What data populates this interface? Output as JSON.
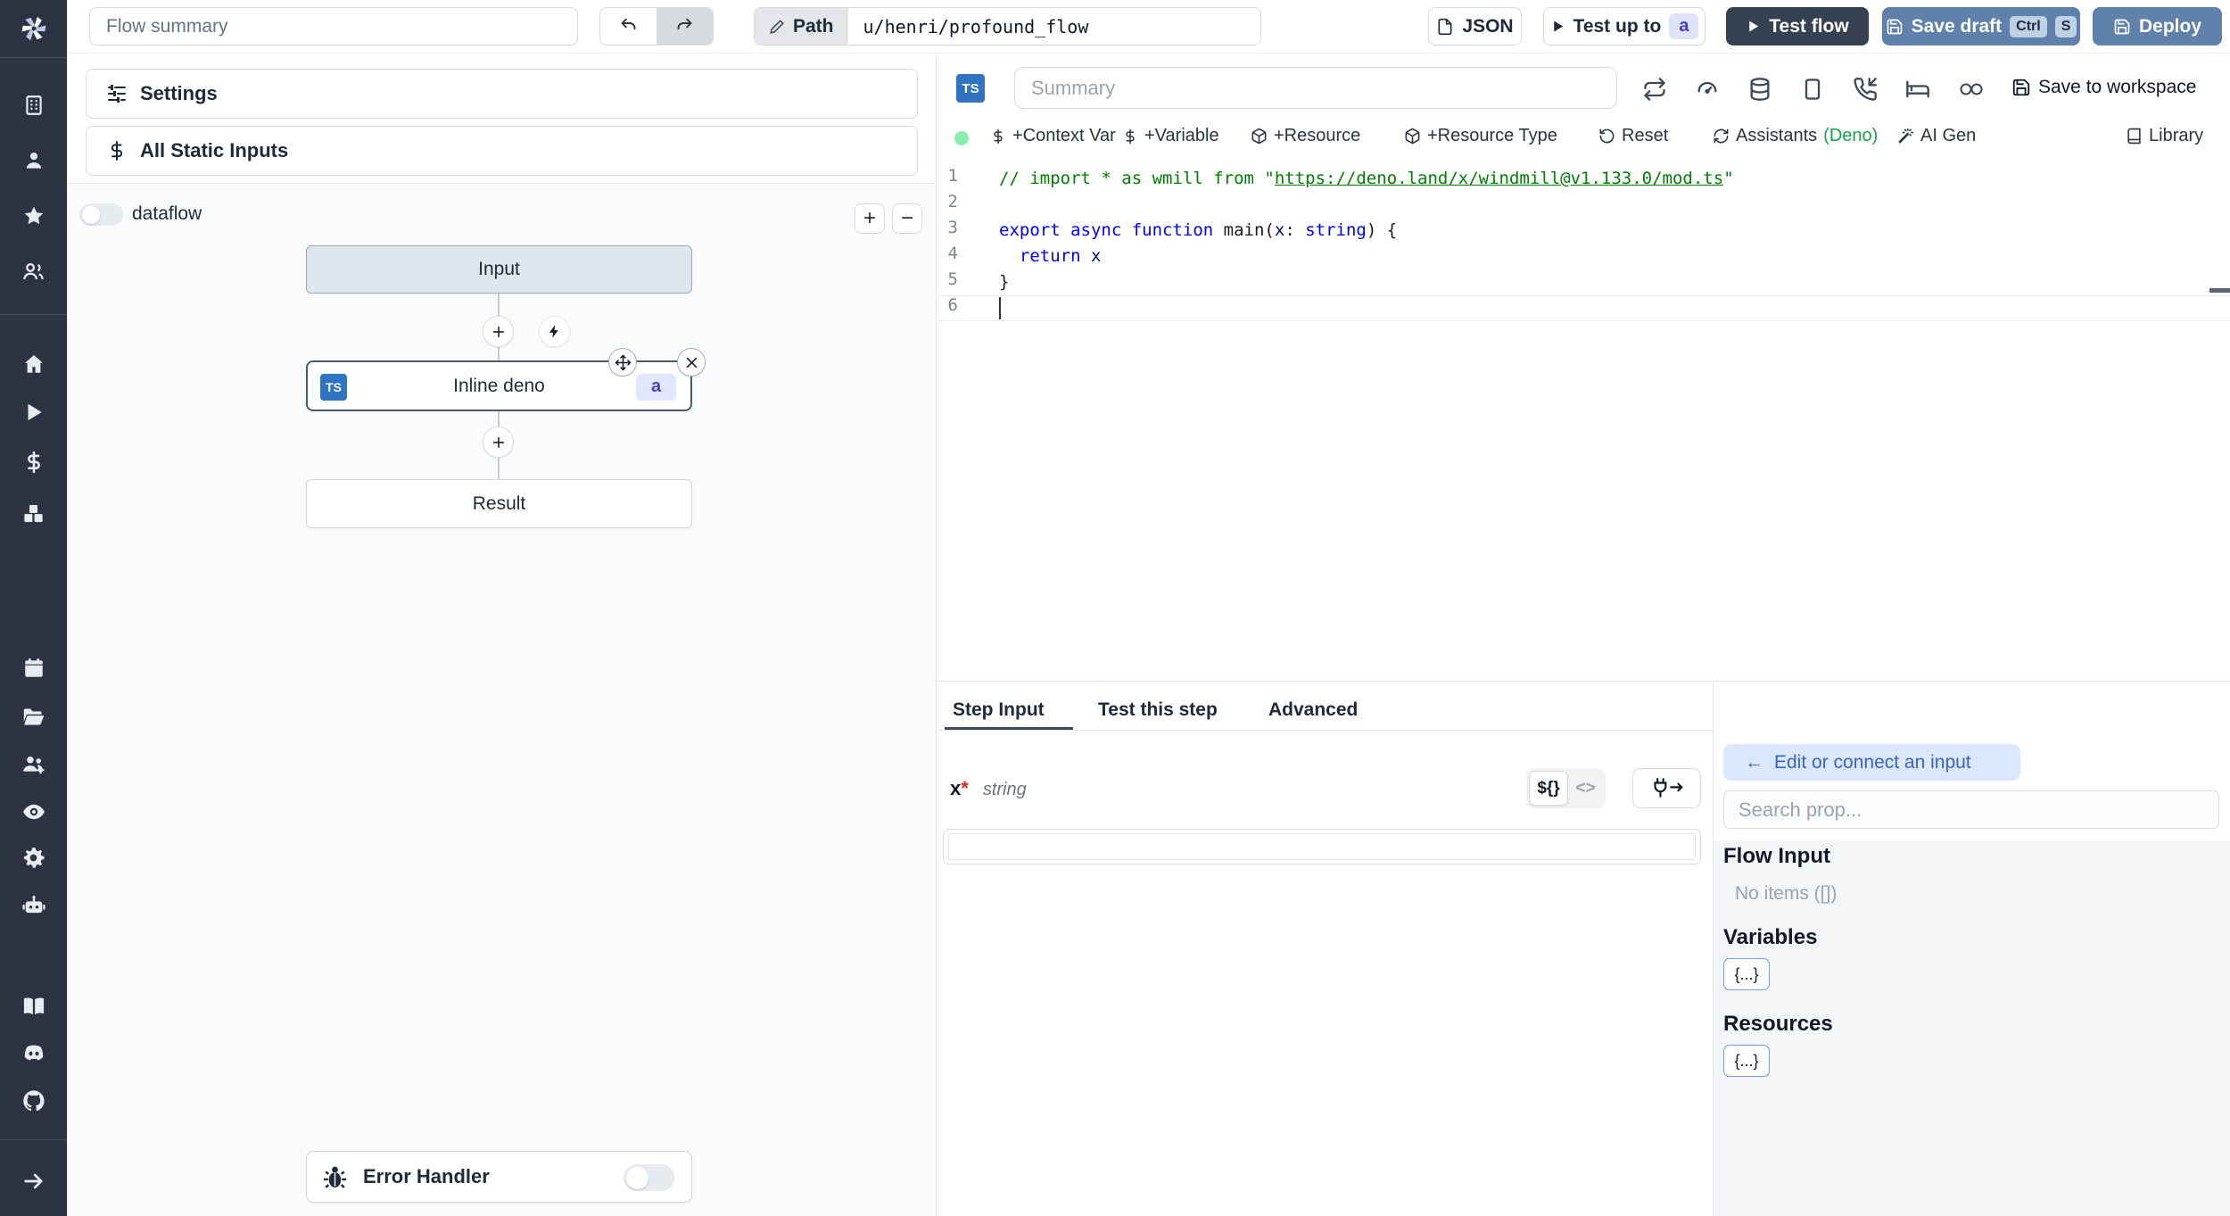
{
  "topbar": {
    "flow_summary_placeholder": "Flow summary",
    "path_label": "Path",
    "path_value": "u/henri/profound_flow",
    "json_button": "JSON",
    "test_up_to": "Test up to",
    "test_up_to_badge": "a",
    "test_flow": "Test flow",
    "save_draft": "Save draft",
    "kbd_ctrl": "Ctrl",
    "kbd_s": "S",
    "deploy": "Deploy"
  },
  "sidebar_icons": [
    "windmill-logo",
    "building",
    "user",
    "star",
    "users",
    "home",
    "play",
    "dollar",
    "boxes",
    "calendar",
    "folder",
    "users-gear",
    "eye",
    "gear",
    "robot",
    "book",
    "discord",
    "github",
    "arrow-right"
  ],
  "left_panel": {
    "settings": "Settings",
    "all_static_inputs": "All Static Inputs",
    "dataflow_label": "dataflow",
    "zoom_in": "+",
    "zoom_out": "−",
    "nodes": {
      "input": "Input",
      "inline_lang": "TS",
      "inline": "Inline deno",
      "inline_badge": "a",
      "result": "Result",
      "error_handler": "Error Handler"
    }
  },
  "editor": {
    "lang_badge": "TS",
    "summary_placeholder": "Summary",
    "save_to_workspace": "Save to workspace",
    "header_icons": [
      "repeat",
      "gauge",
      "database",
      "smartphone",
      "phone-incoming",
      "bed",
      "infinity"
    ],
    "toolbar": {
      "context_var": "+Context Var",
      "variable": "+Variable",
      "resource": "+Resource",
      "resource_type": "+Resource Type",
      "reset": "Reset",
      "assistants": "Assistants",
      "assistants_lang": "(Deno)",
      "ai_gen": "AI Gen",
      "library": "Library"
    },
    "code": {
      "numbers": [
        "1",
        "2",
        "3",
        "4",
        "5",
        "6"
      ],
      "lines": [
        [
          {
            "t": "// import * as wmill from \"",
            "c": "com"
          },
          {
            "t": "https://deno.land/x/windmill@v1.133.0/mod.ts",
            "c": "link"
          },
          {
            "t": "\"",
            "c": "com"
          }
        ],
        [],
        [
          {
            "t": "export async function",
            "c": "kw"
          },
          {
            "t": " main(",
            "c": "pl"
          },
          {
            "t": "x",
            "c": "var"
          },
          {
            "t": ": ",
            "c": "pl"
          },
          {
            "t": "string",
            "c": "kw"
          },
          {
            "t": ") {",
            "c": "pl"
          }
        ],
        [
          {
            "t": "  ",
            "c": "pl"
          },
          {
            "t": "return",
            "c": "kw"
          },
          {
            "t": " ",
            "c": "pl"
          },
          {
            "t": "x",
            "c": "var"
          }
        ],
        [
          {
            "t": "}",
            "c": "pl"
          }
        ],
        []
      ]
    }
  },
  "step_panel": {
    "tabs": [
      "Step Input",
      "Test this step",
      "Advanced"
    ],
    "field_name": "x",
    "required_mark": "*",
    "field_type": "string",
    "toggle_template": "${}",
    "toggle_code": "<>"
  },
  "connect_panel": {
    "edit_button_arrow": "←",
    "edit_button": "Edit or connect an input",
    "search_placeholder": "Search prop...",
    "flow_input_title": "Flow Input",
    "no_items": "No items ([])",
    "variables_title": "Variables",
    "resources_title": "Resources",
    "braces_button": "{...}"
  }
}
